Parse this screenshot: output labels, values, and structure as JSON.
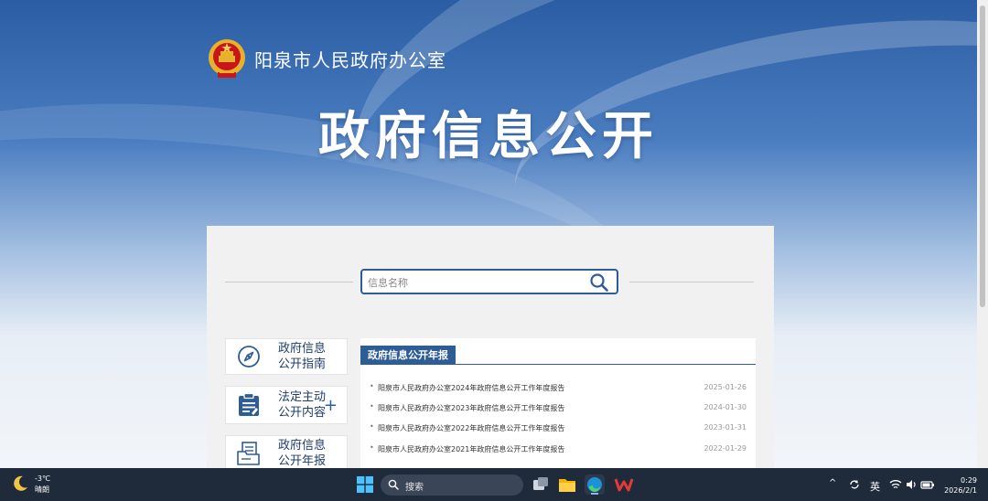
{
  "header": {
    "site_name": "阳泉市人民政府办公室",
    "hero_title": "政府信息公开"
  },
  "search": {
    "placeholder": "信息名称"
  },
  "sidebar": {
    "items": [
      {
        "label": "政府信息公开指南",
        "icon": "compass-icon"
      },
      {
        "label": "法定主动公开内容",
        "icon": "clipboard-list-icon",
        "has_plus": true
      },
      {
        "label": "政府信息公开年报",
        "icon": "folder-document-icon"
      }
    ]
  },
  "news": {
    "tab_label": "政府信息公开年报",
    "items": [
      {
        "title": "阳泉市人民政府办公室2024年政府信息公开工作年度报告",
        "date": "2025-01-26"
      },
      {
        "title": "阳泉市人民政府办公室2023年政府信息公开工作年度报告",
        "date": "2024-01-30"
      },
      {
        "title": "阳泉市人民政府办公室2022年政府信息公开工作年度报告",
        "date": "2023-01-31"
      },
      {
        "title": "阳泉市人民政府办公室2021年政府信息公开工作年度报告",
        "date": "2022-01-29"
      }
    ]
  },
  "taskbar": {
    "weather_temp": "-3℃",
    "weather_desc": "晴朗",
    "search_label": "搜索",
    "ime": "英",
    "time": "0:29",
    "date": "2026/2/1"
  },
  "colors": {
    "brand_blue": "#2e5d96",
    "taskbar": "#1f2a3b"
  }
}
